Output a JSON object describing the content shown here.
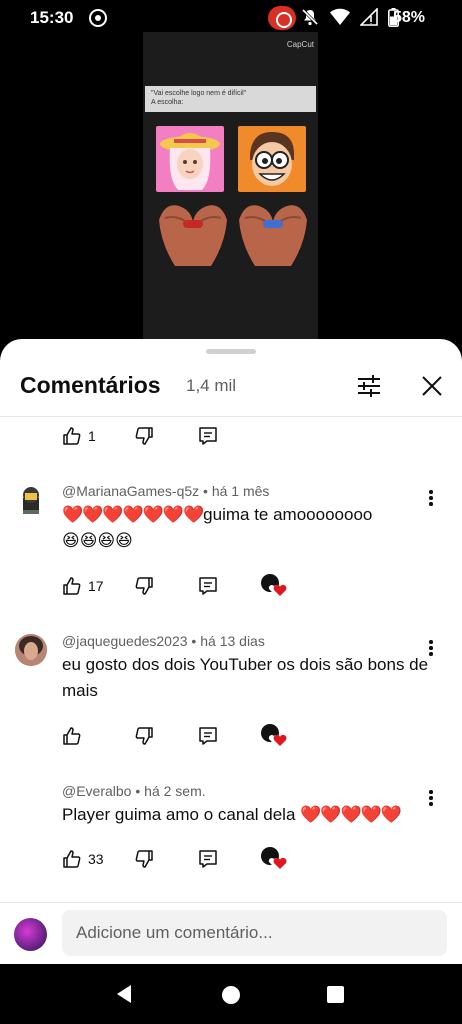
{
  "status_bar": {
    "time": "15:30",
    "battery": "58%"
  },
  "video": {
    "watermark": "CapCut",
    "quote_line1": "\"Vai escolhe logo nem é difícil\"",
    "quote_line2": "A escolha:"
  },
  "sheet": {
    "title": "Comentários",
    "count": "1,4 mil"
  },
  "comments": [
    {
      "like_count": "1"
    },
    {
      "author": "@MarianaGames-q5z",
      "time": "há 1 mês",
      "text_hearts": "❤️❤️❤️❤️❤️❤️❤️",
      "text": "guima te amoooooooo",
      "text_line2": "😆😆😆😆",
      "like_count": "17"
    },
    {
      "author": "@jaqueguedes2023",
      "time": "há 13 dias",
      "text": "eu gosto dos dois YouTuber os dois são bons de mais",
      "like_count": ""
    },
    {
      "author": "@Everalbo",
      "time": "há 2 sem.",
      "text": "Player guima amo o canal dela ",
      "text_hearts": "❤️❤️❤️❤️❤️",
      "like_count": "33"
    }
  ],
  "input": {
    "placeholder": "Adicione um comentário..."
  },
  "colors": {
    "accent_red": "#e0171f",
    "secondary_text": "#606060",
    "sheet_bg": "#ffffff"
  }
}
